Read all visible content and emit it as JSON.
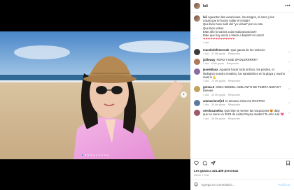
{
  "post": {
    "username": "lali",
    "more_icon": "more-horizontal-icon",
    "caption_lines": [
      "Aguanten las vacaciones, los amigos, el amor y las",
      "cosas que te hacen soltar el celular!",
      "Que bien hace salir del \"yo virtual\" por un rato.",
      "Que bien volver.",
      "Este año lo vamos a dar todooooooooo!!!",
      "Dale que hoy venís a tirarte a bailar!!!! el amor!",
      "❤❤❤❤❤❤❤❤❤❤❤❤❤"
    ],
    "caption_time": "1 día",
    "likes": "Les gusta a 321.409 personas",
    "age": "HACE 1 DÍA"
  },
  "media": {
    "carousel_total": 10,
    "carousel_active": 1,
    "next_icon": "chevron-right-icon"
  },
  "comments": [
    {
      "user": "mundotiefenovook",
      "text": "Que ganas de los veleccio",
      "time": "1 día",
      "likes": "37 Me gusta",
      "reply": "Responder"
    },
    {
      "user": "jailloway",
      "text": "FERO Y ESE SPOILERRRRR?",
      "time": "1 día",
      "likes": "6 Me gusta",
      "reply": "Responder"
    },
    {
      "user": "jeaneblasa",
      "text": "Aguante hacer todo al lloco, los perdeo, el ilodegnio nuestro revaleto, los sandwiches en la playa y mucho mas! ♥ 💪",
      "time": "1 día",
      "likes": "73 Me gusta",
      "reply": "Responder"
    },
    {
      "user": "gonna.9",
      "text": "OSEA EEEEEL ADELANTO DE TEMITA NUEVO? Eeeeee",
      "time": "1 día",
      "likes": "40 Me gusta",
      "reply": "Responder"
    },
    {
      "user": "ammacinnofjrd",
      "text": "te amoooo mira ese ROSTRO",
      "time": "1 día",
      "likes": "35 Me gusta",
      "reply": "Responder"
    },
    {
      "user": "serolucanetha",
      "text": "Que bien te vienen las vacaciones 😍 date que no viene un 2023 de éxitos Reyna madre!! Te amo Lali 💖",
      "time": "1 día",
      "likes": "38 Me gusta",
      "reply": "Responder"
    }
  ],
  "actions": {
    "like_icon": "heart-icon",
    "comment_icon": "comment-icon",
    "share_icon": "share-icon",
    "save_icon": "bookmark-icon"
  },
  "add_comment": {
    "emoji_icon": "emoji-icon",
    "placeholder": "Agrega un comentario...",
    "post_label": "Publicar"
  },
  "colors": {
    "link_blue": "#3897f0",
    "post_disabled": "#b3dbff",
    "muted": "#8e8e8e"
  }
}
